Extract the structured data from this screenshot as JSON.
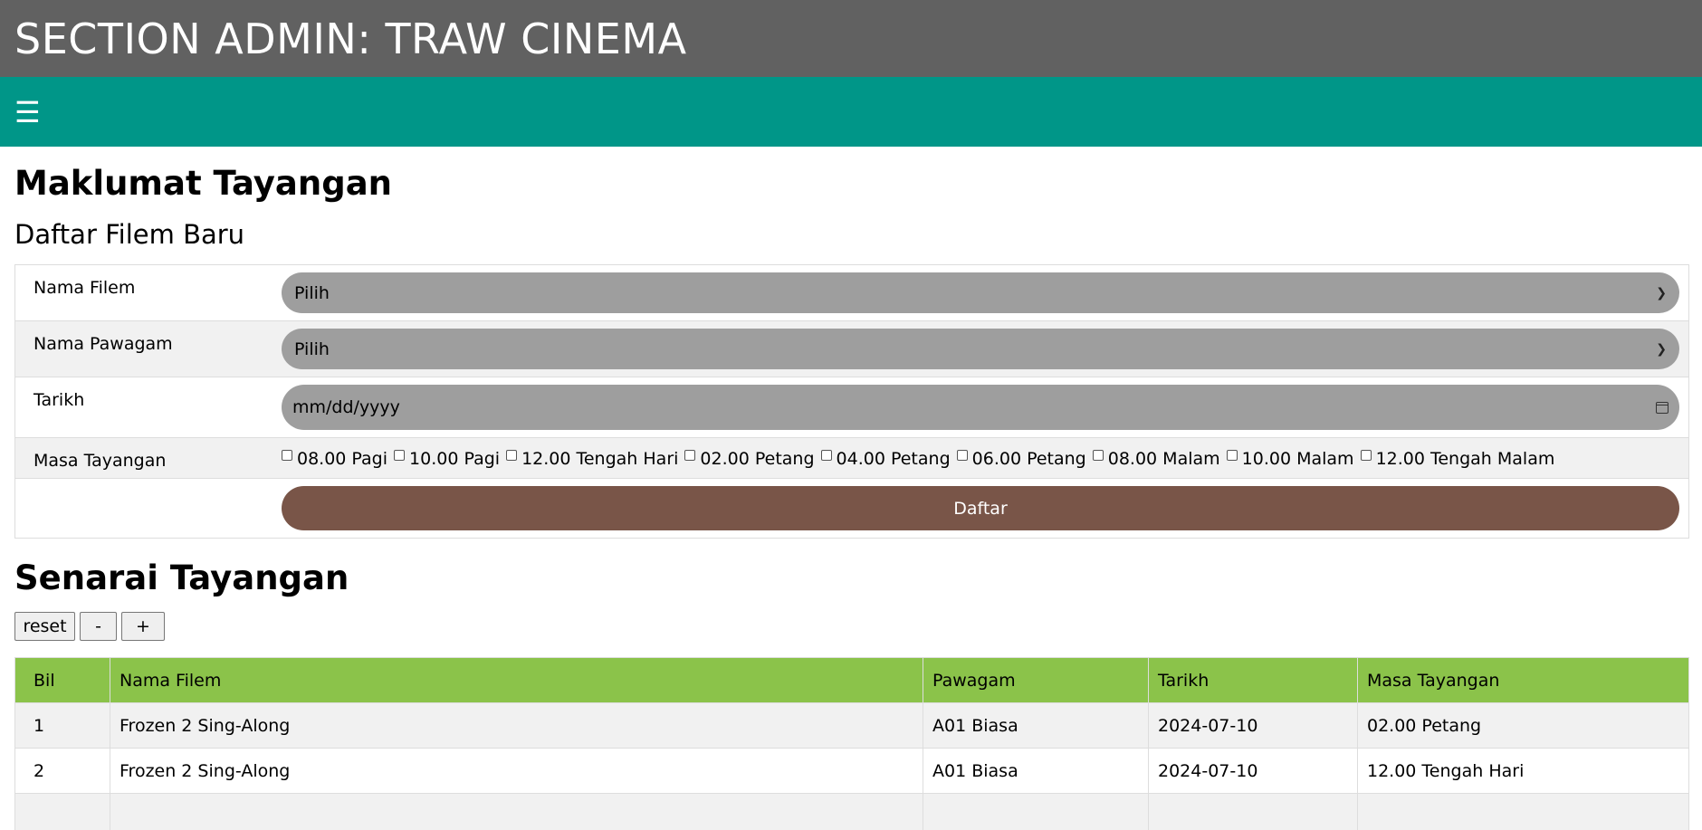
{
  "header": {
    "title": "SECTION ADMIN: TRAW CINEMA"
  },
  "nav": {
    "menu_icon": "☰"
  },
  "page": {
    "title": "Maklumat Tayangan",
    "subtitle": "Daftar Filem Baru"
  },
  "form": {
    "film_label": "Nama Filem",
    "film_value": "Pilih",
    "hall_label": "Nama Pawagam",
    "hall_value": "Pilih",
    "date_label": "Tarikh",
    "date_placeholder": "mm/dd/yyyy",
    "time_label": "Masa Tayangan",
    "times": [
      "08.00 Pagi",
      "10.00 Pagi",
      "12.00 Tengah Hari",
      "02.00 Petang",
      "04.00 Petang",
      "06.00 Petang",
      "08.00 Malam",
      "10.00 Malam",
      "12.00 Tengah Malam"
    ],
    "submit_label": "Daftar"
  },
  "list": {
    "title": "Senarai Tayangan",
    "buttons": {
      "reset": "reset",
      "minus": "-",
      "plus": "+"
    },
    "columns": [
      "Bil",
      "Nama Filem",
      "Pawagam",
      "Tarikh",
      "Masa Tayangan"
    ],
    "rows": [
      [
        "1",
        "Frozen 2 Sing-Along",
        "A01 Biasa",
        "2024-07-10",
        "02.00 Petang"
      ],
      [
        "2",
        "Frozen 2 Sing-Along",
        "A01 Biasa",
        "2024-07-10",
        "12.00 Tengah Hari"
      ]
    ]
  },
  "colors": {
    "header_bg": "#616161",
    "nav_bg": "#009688",
    "select_bg": "#9e9e9e",
    "submit_bg": "#795548",
    "table_header_bg": "#8bc34a"
  }
}
